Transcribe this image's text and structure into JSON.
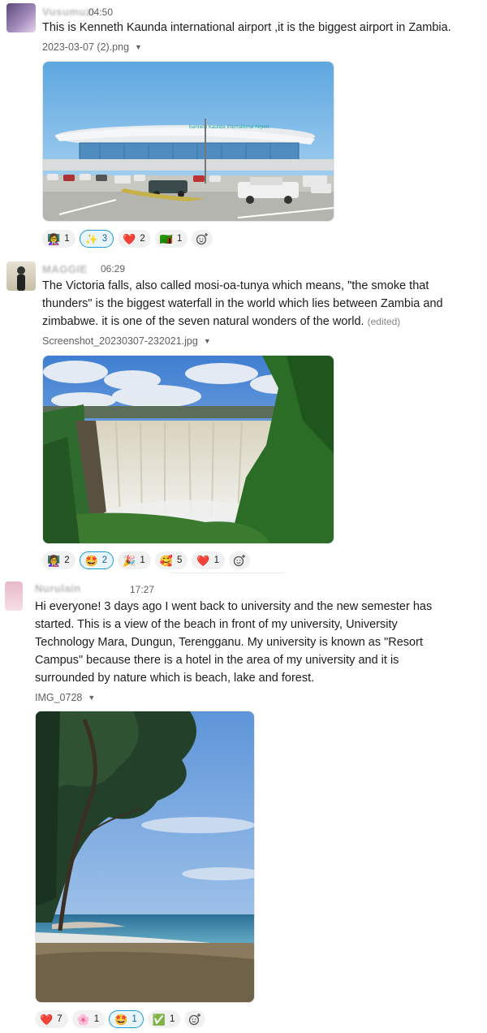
{
  "messages": [
    {
      "author": "Vusumuzi",
      "time": "04:50",
      "text": "This is Kenneth Kaunda international airport ,it is the biggest airport in Zambia.",
      "file": "2023-03-07 (2).png",
      "image_sign": "Kenneth Kaunda International Airport",
      "reactions": [
        {
          "emoji": "👩‍🏫",
          "count": "1",
          "active": false
        },
        {
          "emoji": "✨",
          "count": "3",
          "active": true
        },
        {
          "emoji": "❤️",
          "count": "2",
          "active": false
        },
        {
          "emoji": "🇿🇲",
          "count": "1",
          "active": false
        }
      ]
    },
    {
      "author": "MAGGIE",
      "time": "06:29",
      "text": "The Victoria falls, also called mosi-oa-tunya which means, \"the smoke that thunders\" is the biggest waterfall in the world which lies between Zambia and zimbabwe. it is one of the seven natural wonders of the world.",
      "edited": "(edited)",
      "file": "Screenshot_20230307-232021.jpg",
      "reactions": [
        {
          "emoji": "👩‍🏫",
          "count": "2",
          "active": false
        },
        {
          "emoji": "🤩",
          "count": "2",
          "active": true
        },
        {
          "emoji": "🎉",
          "count": "1",
          "active": false
        },
        {
          "emoji": "🥰",
          "count": "5",
          "active": false
        },
        {
          "emoji": "❤️",
          "count": "1",
          "active": false
        }
      ]
    },
    {
      "author": "Nurulain",
      "time": "17:27",
      "text": "Hi everyone! 3 days ago I went back to university and the new semester has started. This is a view of the beach in front of my university, University Technology Mara, Dungun, Terengganu. My university is known as \"Resort Campus\" because there is a hotel in the area of my university and it is surrounded by nature which is beach, lake and forest.",
      "file": "IMG_0728",
      "reactions": [
        {
          "emoji": "❤️",
          "count": "7",
          "active": false
        },
        {
          "emoji": "🌸",
          "count": "1",
          "active": false
        },
        {
          "emoji": "🤩",
          "count": "1",
          "active": true
        },
        {
          "emoji": "✅",
          "count": "1",
          "active": false
        }
      ]
    }
  ],
  "icons": {
    "caret": "caret-down-icon",
    "add_reaction": "add-reaction-icon"
  },
  "colors": {
    "active_border": "#1d9bd1",
    "active_bg": "#e8f5fa",
    "pill_bg": "#f1f1f1"
  }
}
